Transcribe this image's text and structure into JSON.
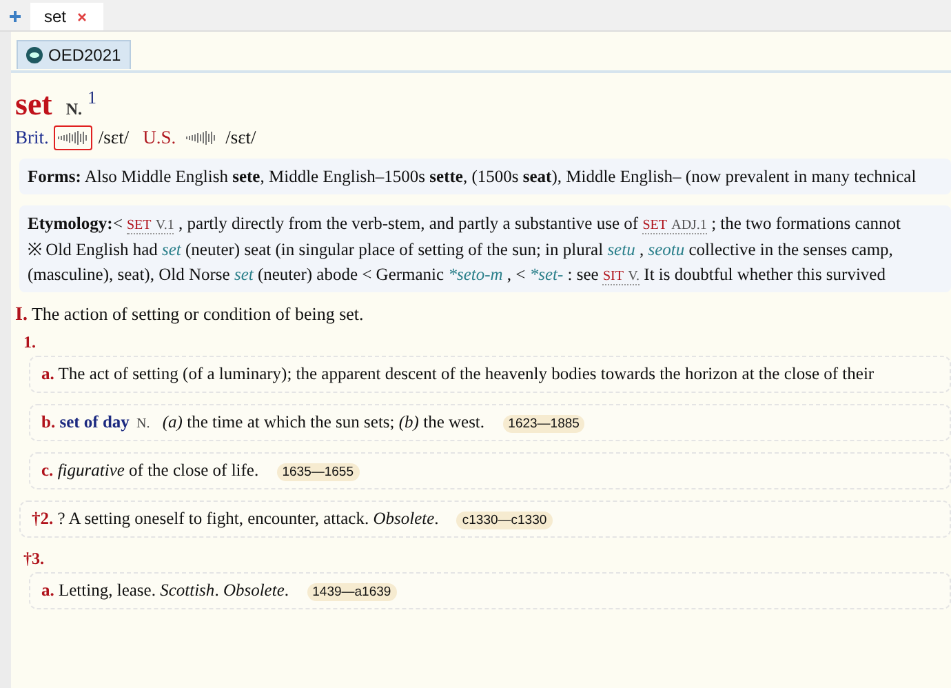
{
  "tabs": [
    {
      "label": "set",
      "selected": true
    }
  ],
  "dictionary_tab": {
    "label": "OED2021",
    "selected": true
  },
  "headword": {
    "word": "set",
    "pos": "N.",
    "homonym": "1"
  },
  "pronunciations": [
    {
      "label": "Brit.",
      "ipa": "/sɛt/",
      "selected": true
    },
    {
      "label": "U.S.",
      "ipa": "/sɛt/",
      "selected": false
    }
  ],
  "forms": {
    "label": "Forms:",
    "text": "Also Middle English **sete**, Middle English–1500s **sette**, (1500s **seat**), Middle English– (now prevalent in many technical"
  },
  "etymology": {
    "label": "Etymology:",
    "paragraphs": [
      [
        {
          "kind": "text",
          "text": "<"
        },
        {
          "kind": "xref",
          "word": "SET",
          "pos": "V.1"
        },
        {
          "kind": "text",
          "text": ", partly directly from the verb-stem, and partly a substantive use of"
        },
        {
          "kind": "xref",
          "word": "SET",
          "pos": "ADJ.1"
        },
        {
          "kind": "text",
          "text": "; the two formations cannot"
        }
      ],
      [
        {
          "kind": "text",
          "text": "※ Old English had"
        },
        {
          "kind": "form",
          "text": "set"
        },
        {
          "kind": "text",
          "text": "(neuter) seat (in singular place of setting of the sun; in plural"
        },
        {
          "kind": "form",
          "text": "setu"
        },
        {
          "kind": "text",
          "text": ","
        },
        {
          "kind": "form",
          "text": "seotu"
        },
        {
          "kind": "text",
          "text": "collective in the senses camp, (masculine), seat), Old Norse"
        },
        {
          "kind": "form",
          "text": "set"
        },
        {
          "kind": "text",
          "text": "(neuter) abode < Germanic"
        },
        {
          "kind": "form",
          "text": "*seto-m"
        },
        {
          "kind": "text",
          "text": ", <"
        },
        {
          "kind": "form",
          "text": "*set-"
        },
        {
          "kind": "text",
          "text": ": see"
        },
        {
          "kind": "xref",
          "word": "SIT",
          "pos": "V."
        },
        {
          "kind": "text",
          "text": "It is doubtful whether this survived"
        }
      ]
    ]
  },
  "senses": [
    {
      "number": "I.",
      "text": "The action of setting or condition of being set.",
      "children": [
        {
          "number": "1.",
          "children": [
            {
              "number": "a.",
              "text": "The act of setting (of a luminary); the apparent descent of the heavenly bodies towards the horizon at the close of their"
            },
            {
              "number": "b.",
              "phrase": "set of day",
              "pos": "N.",
              "text": "*(a)* the time at which the sun sets; *(b)* the west.",
              "dates": "1623—1885"
            },
            {
              "number": "c.",
              "text": "*figurative* of the close of life.",
              "dates": "1635—1655"
            }
          ]
        },
        {
          "number": "†2.",
          "text": "? A setting oneself to fight, encounter, attack. *Obsolete*.",
          "dates": "c1330—c1330"
        },
        {
          "number": "†3.",
          "children": [
            {
              "number": "a.",
              "text": "Letting, lease. *Scottish*. *Obsolete*.",
              "dates": "1439—a1639"
            }
          ]
        }
      ]
    }
  ]
}
